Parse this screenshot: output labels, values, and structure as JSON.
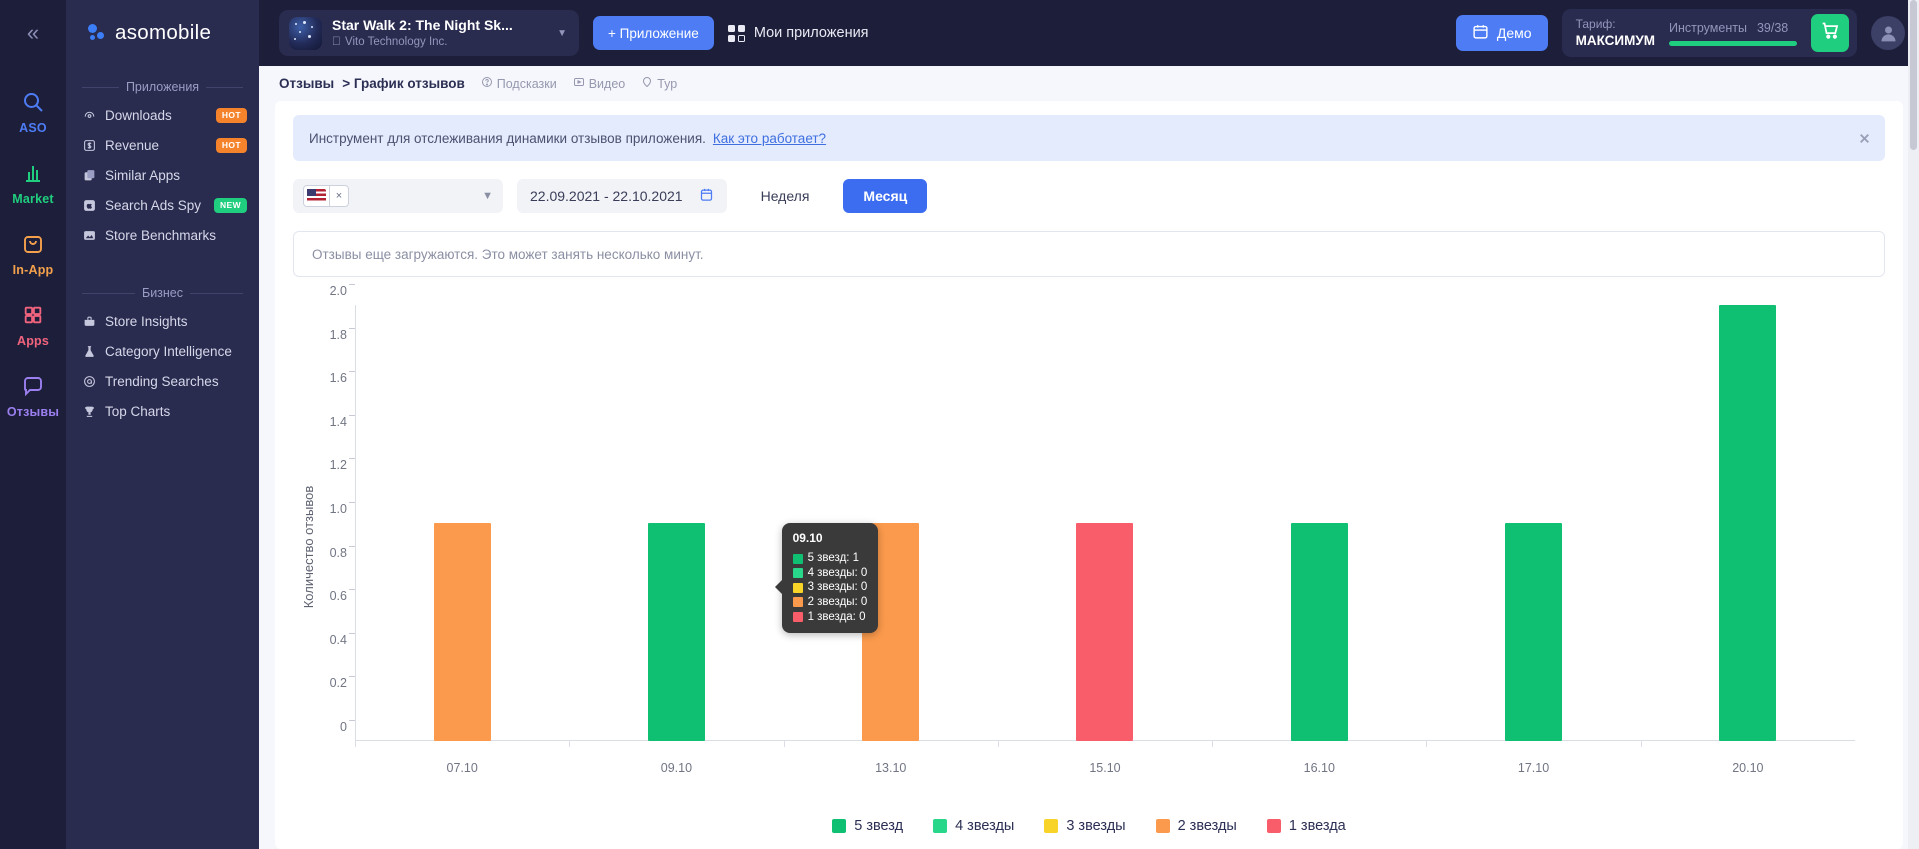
{
  "rail": {
    "collapse_label": "«",
    "items": [
      {
        "label": "ASO",
        "icon": "search-icon",
        "color": "#4d7cf5"
      },
      {
        "label": "Market",
        "icon": "bar-chart-icon",
        "color": "#1fce7e"
      },
      {
        "label": "In-App",
        "icon": "bag-icon",
        "color": "#f5a14c"
      },
      {
        "label": "Apps",
        "icon": "grid-icon",
        "color": "#f2637e"
      },
      {
        "label": "Отзывы",
        "icon": "chat-icon",
        "color": "#9b7ff0"
      }
    ]
  },
  "sidebar": {
    "brand": "asomobile",
    "sections": [
      {
        "title": "Приложения",
        "items": [
          {
            "label": "Downloads",
            "icon": "download-icon",
            "badge": "HOT",
            "badge_type": "hot"
          },
          {
            "label": "Revenue",
            "icon": "dollar-icon",
            "badge": "HOT",
            "badge_type": "hot"
          },
          {
            "label": "Similar Apps",
            "icon": "copy-icon",
            "badge": "",
            "badge_type": ""
          },
          {
            "label": "Search Ads Spy",
            "icon": "apple-icon",
            "badge": "NEW",
            "badge_type": "new"
          },
          {
            "label": "Store Benchmarks",
            "icon": "image-icon",
            "badge": "",
            "badge_type": ""
          }
        ]
      },
      {
        "title": "Бизнес",
        "items": [
          {
            "label": "Store Insights",
            "icon": "briefcase-icon",
            "badge": "",
            "badge_type": ""
          },
          {
            "label": "Category Intelligence",
            "icon": "flask-icon",
            "badge": "",
            "badge_type": ""
          },
          {
            "label": "Trending Searches",
            "icon": "target-icon",
            "badge": "",
            "badge_type": ""
          },
          {
            "label": "Top Charts",
            "icon": "trophy-icon",
            "badge": "",
            "badge_type": ""
          }
        ]
      }
    ]
  },
  "topbar": {
    "app_title": "Star Walk 2: The Night Sk...",
    "app_developer": "Vito Technology Inc.",
    "add_app_label": "+ Приложение",
    "my_apps_label": "Мои приложения",
    "demo_label": "Демо",
    "plan_label": "Тариф:",
    "plan_value": "МАКСИМУМ",
    "tools_label": "Инструменты",
    "tools_count": "39/38",
    "cart_icon": "cart-icon",
    "avatar_icon": "user-avatar-icon"
  },
  "breadcrumb": {
    "root": "Отзывы",
    "current": "> График отзывов",
    "links": [
      {
        "label": "Подсказки",
        "icon": "question-icon"
      },
      {
        "label": "Видео",
        "icon": "play-icon"
      },
      {
        "label": "Тур",
        "icon": "tour-icon"
      }
    ]
  },
  "notice": {
    "text": "Инструмент для отслеживания динамики отзывов приложения.",
    "link": "Как это работает?",
    "close_icon": "close-icon"
  },
  "controls": {
    "country_flag": "us-flag",
    "country_clear": "×",
    "date_range": "22.09.2021 - 22.10.2021",
    "calendar_icon": "calendar-icon",
    "week_label": "Неделя",
    "month_label": "Месяц"
  },
  "loading": {
    "text": "Отзывы еще загружаются. Это может занять несколько минут."
  },
  "tooltip": {
    "date": "09.10",
    "rows": [
      {
        "label": "5 звезд: 1",
        "color": "#0fbf72"
      },
      {
        "label": "4 звезды: 0",
        "color": "#28d78a"
      },
      {
        "label": "3 звезды: 0",
        "color": "#f8d428"
      },
      {
        "label": "2 звезды: 0",
        "color": "#fb9a4c"
      },
      {
        "label": "1 звезда: 0",
        "color": "#f95d6a"
      }
    ]
  },
  "chart_data": {
    "type": "bar",
    "title": "",
    "xlabel": "",
    "ylabel": "Количество отзывов",
    "categories": [
      "07.10",
      "09.10",
      "13.10",
      "15.10",
      "16.10",
      "17.10",
      "20.10"
    ],
    "values": [
      1,
      1,
      1,
      1,
      1,
      1,
      2
    ],
    "bar_colors": [
      "#fb9a4c",
      "#0fbf72",
      "#fb9a4c",
      "#f95d6a",
      "#0fbf72",
      "#0fbf72",
      "#0fbf72"
    ],
    "bar_series": [
      "2 звезды",
      "5 звезд",
      "2 звезды",
      "1 звезда",
      "5 звезд",
      "5 звезд",
      "5 звезд"
    ],
    "ylim": [
      0,
      2
    ],
    "yticks": [
      "0",
      "0.2",
      "0.4",
      "0.6",
      "0.8",
      "1.0",
      "1.2",
      "1.4",
      "1.6",
      "1.8",
      "2.0"
    ],
    "grid": false,
    "legend_position": "bottom",
    "series": [
      {
        "name": "5 звезд",
        "color": "#0fbf72",
        "values": [
          0,
          1,
          0,
          0,
          1,
          1,
          2
        ]
      },
      {
        "name": "4 звезды",
        "color": "#28d78a",
        "values": [
          0,
          0,
          0,
          0,
          0,
          0,
          0
        ]
      },
      {
        "name": "3 звезды",
        "color": "#f8d428",
        "values": [
          0,
          0,
          0,
          0,
          0,
          0,
          0
        ]
      },
      {
        "name": "2 звезды",
        "color": "#fb9a4c",
        "values": [
          1,
          0,
          1,
          0,
          0,
          0,
          0
        ]
      },
      {
        "name": "1 звезда",
        "color": "#f95d6a",
        "values": [
          0,
          0,
          0,
          1,
          0,
          0,
          0
        ]
      }
    ]
  }
}
